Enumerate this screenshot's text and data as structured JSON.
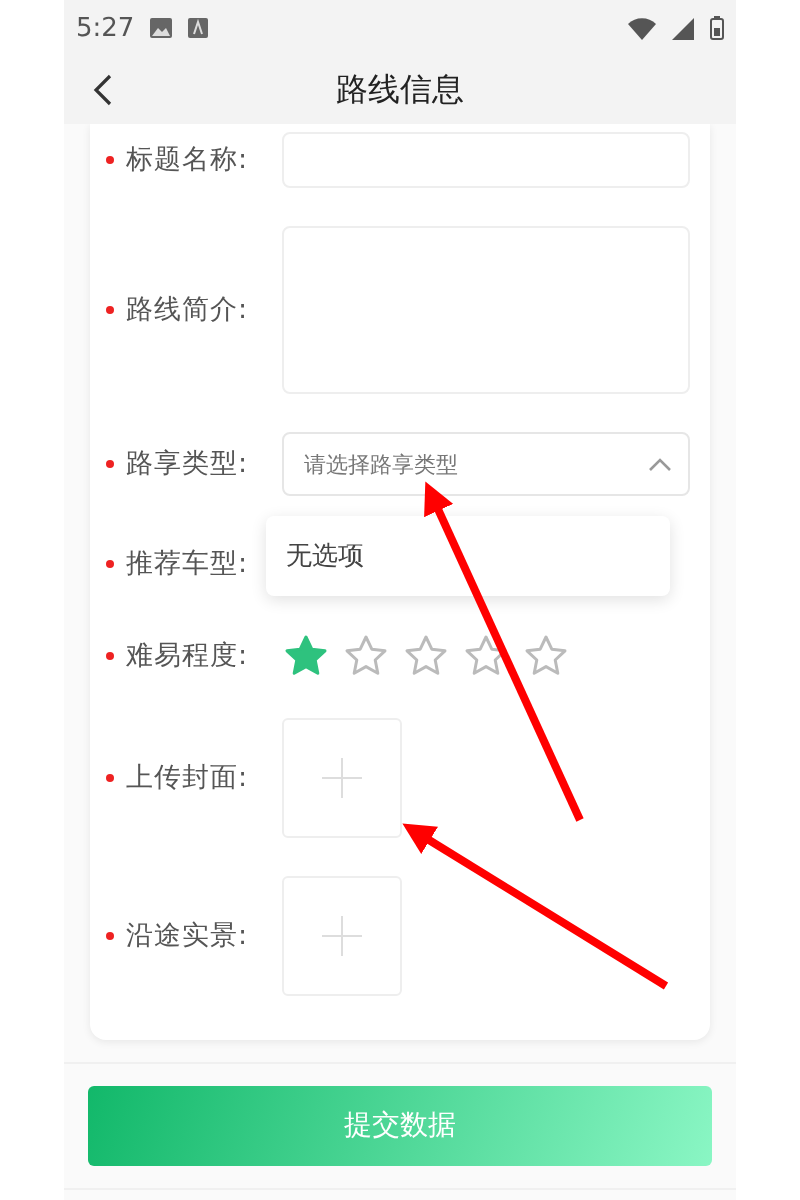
{
  "status_bar": {
    "time": "5:27"
  },
  "header": {
    "title": "路线信息"
  },
  "fields": [
    {
      "kind": "text",
      "label": "标题名称:",
      "required": true
    },
    {
      "kind": "textarea",
      "label": "路线简介:",
      "required": true
    },
    {
      "kind": "select",
      "label": "路享类型:",
      "required": true,
      "placeholder": "请选择路享类型",
      "expanded": true,
      "dropdown_message": "无选项"
    },
    {
      "kind": "covered",
      "label": "推荐车型:",
      "required": true
    },
    {
      "kind": "rating",
      "label": "难易程度:",
      "required": true,
      "stars": 1
    },
    {
      "kind": "upload",
      "label": "上传封面:",
      "required": true
    },
    {
      "kind": "upload",
      "label": "沿途实景:",
      "required": true
    }
  ],
  "submit_button": "提交数据"
}
